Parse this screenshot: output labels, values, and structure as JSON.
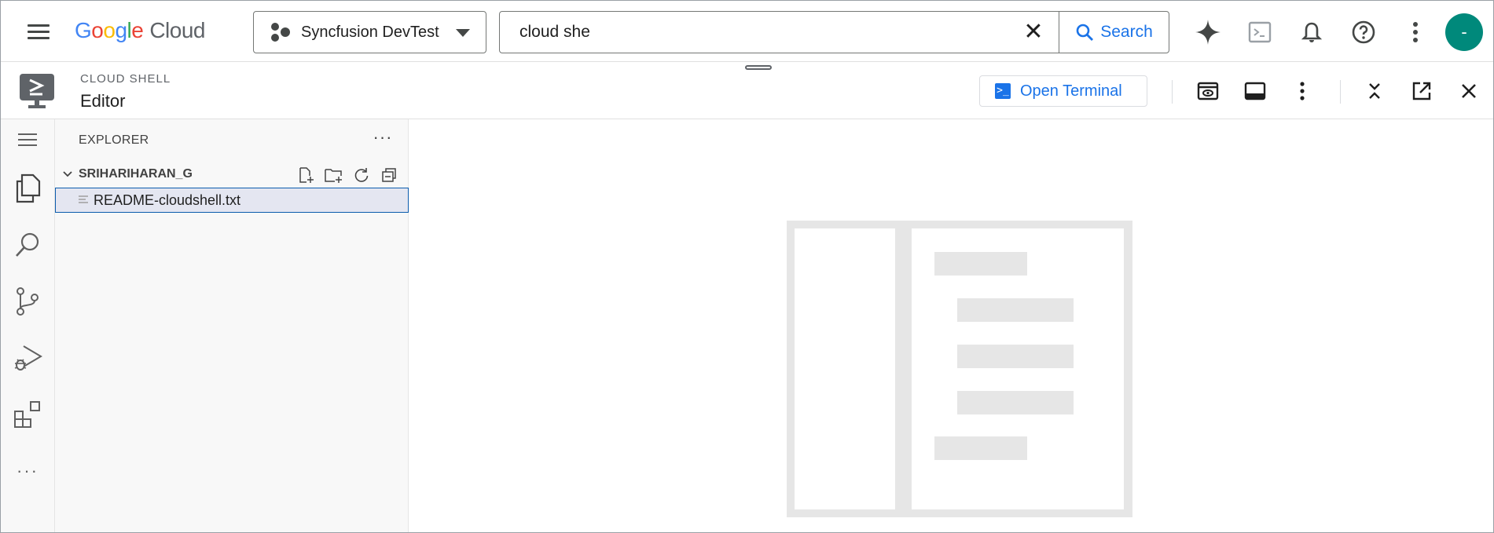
{
  "header": {
    "logo": {
      "g1": "G",
      "o1": "o",
      "o2": "o",
      "g2": "g",
      "l": "l",
      "e": "e",
      "cloud": "Cloud"
    },
    "project": {
      "name": "Syncfusion DevTest"
    },
    "search": {
      "value": "cloud she",
      "button_label": "Search"
    },
    "avatar_initial": "-",
    "icons": [
      "menu-icon",
      "gemini-sparkle-icon",
      "cloud-shell-terminal-icon",
      "notifications-bell-icon",
      "help-icon",
      "more-vert-icon"
    ]
  },
  "cloud_shell": {
    "kicker": "CLOUD SHELL",
    "title": "Editor",
    "open_terminal_label": "Open Terminal",
    "open_terminal_glyph": ">_"
  },
  "explorer": {
    "title": "EXPLORER",
    "more_label": "···",
    "folder": "SRIHARIHARAN_G",
    "files": [
      {
        "name": "README-cloudshell.txt",
        "selected": true
      }
    ]
  },
  "activity_bar": {
    "items": [
      "menu-icon",
      "explorer-files-icon",
      "search-icon",
      "source-control-icon",
      "run-debug-icon",
      "extensions-icon",
      "more-icon"
    ],
    "more_label": "···"
  },
  "colors": {
    "accent": "#1a73e8",
    "avatar": "#00897b",
    "selection_bg": "#e4e6f1",
    "selection_border": "#0b5cad"
  }
}
